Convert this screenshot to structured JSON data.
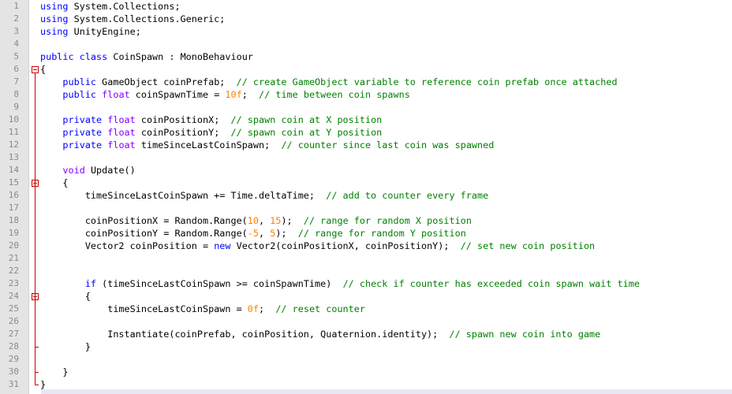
{
  "editor": {
    "lines": [
      {
        "n": "1",
        "tokens": [
          {
            "t": "using",
            "c": "kw"
          },
          {
            "t": " System.Collections;",
            "c": "plain"
          }
        ]
      },
      {
        "n": "2",
        "tokens": [
          {
            "t": "using",
            "c": "kw"
          },
          {
            "t": " System.Collections.Generic;",
            "c": "plain"
          }
        ]
      },
      {
        "n": "3",
        "tokens": [
          {
            "t": "using",
            "c": "kw"
          },
          {
            "t": " UnityEngine;",
            "c": "plain"
          }
        ]
      },
      {
        "n": "4",
        "tokens": []
      },
      {
        "n": "5",
        "tokens": [
          {
            "t": "public class",
            "c": "kw"
          },
          {
            "t": " CoinSpawn : MonoBehaviour",
            "c": "plain"
          }
        ]
      },
      {
        "n": "6",
        "tokens": [
          {
            "t": "{",
            "c": "plain"
          }
        ]
      },
      {
        "n": "7",
        "tokens": [
          {
            "t": "    ",
            "c": "plain"
          },
          {
            "t": "public",
            "c": "kw"
          },
          {
            "t": " GameObject coinPrefab;  ",
            "c": "plain"
          },
          {
            "t": "// create GameObject variable to reference coin prefab once attached",
            "c": "cm"
          }
        ]
      },
      {
        "n": "8",
        "tokens": [
          {
            "t": "    ",
            "c": "plain"
          },
          {
            "t": "public",
            "c": "kw"
          },
          {
            "t": " ",
            "c": "plain"
          },
          {
            "t": "float",
            "c": "kw2"
          },
          {
            "t": " coinSpawnTime = ",
            "c": "plain"
          },
          {
            "t": "10f",
            "c": "num"
          },
          {
            "t": ";  ",
            "c": "plain"
          },
          {
            "t": "// time between coin spawns",
            "c": "cm"
          }
        ]
      },
      {
        "n": "9",
        "tokens": []
      },
      {
        "n": "10",
        "tokens": [
          {
            "t": "    ",
            "c": "plain"
          },
          {
            "t": "private",
            "c": "kw"
          },
          {
            "t": " ",
            "c": "plain"
          },
          {
            "t": "float",
            "c": "kw2"
          },
          {
            "t": " coinPositionX;  ",
            "c": "plain"
          },
          {
            "t": "// spawn coin at X position",
            "c": "cm"
          }
        ]
      },
      {
        "n": "11",
        "tokens": [
          {
            "t": "    ",
            "c": "plain"
          },
          {
            "t": "private",
            "c": "kw"
          },
          {
            "t": " ",
            "c": "plain"
          },
          {
            "t": "float",
            "c": "kw2"
          },
          {
            "t": " coinPositionY;  ",
            "c": "plain"
          },
          {
            "t": "// spawn coin at Y position",
            "c": "cm"
          }
        ]
      },
      {
        "n": "12",
        "tokens": [
          {
            "t": "    ",
            "c": "plain"
          },
          {
            "t": "private",
            "c": "kw"
          },
          {
            "t": " ",
            "c": "plain"
          },
          {
            "t": "float",
            "c": "kw2"
          },
          {
            "t": " timeSinceLastCoinSpawn;  ",
            "c": "plain"
          },
          {
            "t": "// counter since last coin was spawned",
            "c": "cm"
          }
        ]
      },
      {
        "n": "13",
        "tokens": []
      },
      {
        "n": "14",
        "tokens": [
          {
            "t": "    ",
            "c": "plain"
          },
          {
            "t": "void",
            "c": "kw2"
          },
          {
            "t": " Update()",
            "c": "plain"
          }
        ]
      },
      {
        "n": "15",
        "tokens": [
          {
            "t": "    {",
            "c": "plain"
          }
        ]
      },
      {
        "n": "16",
        "tokens": [
          {
            "t": "        timeSinceLastCoinSpawn += Time.deltaTime;  ",
            "c": "plain"
          },
          {
            "t": "// add to counter every frame",
            "c": "cm"
          }
        ]
      },
      {
        "n": "17",
        "tokens": []
      },
      {
        "n": "18",
        "tokens": [
          {
            "t": "        coinPositionX = Random.Range(",
            "c": "plain"
          },
          {
            "t": "10",
            "c": "num"
          },
          {
            "t": ", ",
            "c": "plain"
          },
          {
            "t": "15",
            "c": "num"
          },
          {
            "t": ");  ",
            "c": "plain"
          },
          {
            "t": "// range for random X position",
            "c": "cm"
          }
        ]
      },
      {
        "n": "19",
        "tokens": [
          {
            "t": "        coinPositionY = Random.Range(",
            "c": "plain"
          },
          {
            "t": "-5",
            "c": "num"
          },
          {
            "t": ", ",
            "c": "plain"
          },
          {
            "t": "5",
            "c": "num"
          },
          {
            "t": ");  ",
            "c": "plain"
          },
          {
            "t": "// range for random Y position",
            "c": "cm"
          }
        ]
      },
      {
        "n": "20",
        "tokens": [
          {
            "t": "        Vector2 coinPosition = ",
            "c": "plain"
          },
          {
            "t": "new",
            "c": "kw"
          },
          {
            "t": " Vector2(coinPositionX, coinPositionY);  ",
            "c": "plain"
          },
          {
            "t": "// set new coin position",
            "c": "cm"
          }
        ]
      },
      {
        "n": "21",
        "tokens": []
      },
      {
        "n": "22",
        "tokens": []
      },
      {
        "n": "23",
        "tokens": [
          {
            "t": "        ",
            "c": "plain"
          },
          {
            "t": "if",
            "c": "kw"
          },
          {
            "t": " (timeSinceLastCoinSpawn >= coinSpawnTime)  ",
            "c": "plain"
          },
          {
            "t": "// check if counter has exceeded coin spawn wait time",
            "c": "cm"
          }
        ]
      },
      {
        "n": "24",
        "tokens": [
          {
            "t": "        {",
            "c": "plain"
          }
        ]
      },
      {
        "n": "25",
        "tokens": [
          {
            "t": "            timeSinceLastCoinSpawn = ",
            "c": "plain"
          },
          {
            "t": "0f",
            "c": "num"
          },
          {
            "t": ";  ",
            "c": "plain"
          },
          {
            "t": "// reset counter",
            "c": "cm"
          }
        ]
      },
      {
        "n": "26",
        "tokens": []
      },
      {
        "n": "27",
        "tokens": [
          {
            "t": "            Instantiate(coinPrefab, coinPosition, Quaternion.identity);  ",
            "c": "plain"
          },
          {
            "t": "// spawn new coin into game",
            "c": "cm"
          }
        ]
      },
      {
        "n": "28",
        "tokens": [
          {
            "t": "        }",
            "c": "plain"
          }
        ]
      },
      {
        "n": "29",
        "tokens": []
      },
      {
        "n": "30",
        "tokens": [
          {
            "t": "    }",
            "c": "plain"
          }
        ]
      },
      {
        "n": "31",
        "tokens": [
          {
            "t": "}",
            "c": "plain"
          }
        ]
      }
    ],
    "colors": {
      "keyword": "#0000ff",
      "type_keyword": "#8000ff",
      "comment": "#008000",
      "number": "#ff8000",
      "fold_marker": "#cc0000",
      "gutter_bg": "#e4e4e4",
      "line_number": "#8a8a8a"
    },
    "fold_markers": [
      {
        "line": 6,
        "icon": "fold-minus-icon"
      },
      {
        "line": 15,
        "icon": "fold-minus-icon"
      },
      {
        "line": 24,
        "icon": "fold-minus-icon"
      }
    ]
  }
}
